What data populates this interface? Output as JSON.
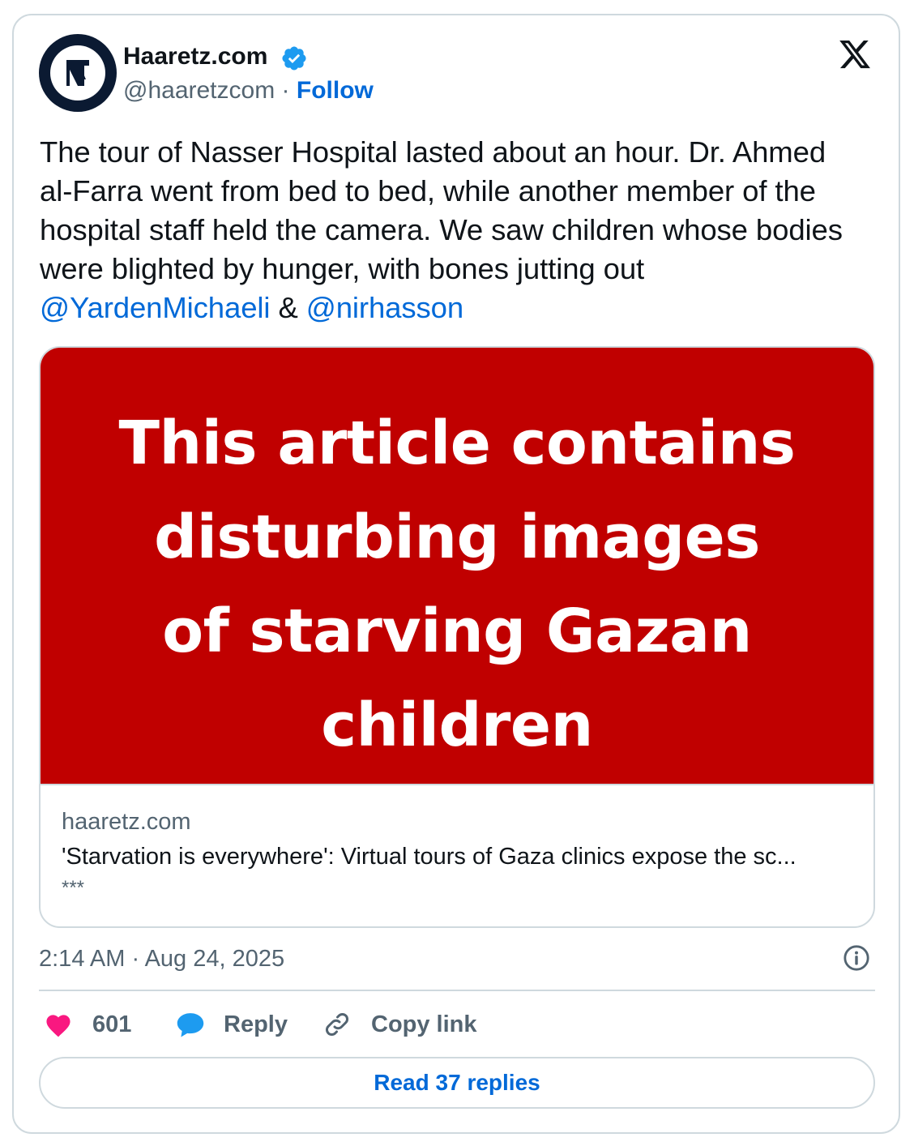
{
  "author": {
    "name": "Haaretz.com",
    "handle": "@haaretzcom",
    "separator": "·",
    "follow_label": "Follow"
  },
  "tweet": {
    "text_intro": "The tour of Nasser Hospital lasted about an hour. Dr. Ahmed al-Farra went from bed to bed, while another member of the hospital staff held the camera. We saw children whose bodies were blighted by hunger, with bones jutting out ",
    "mention_1": "@YardenMichaeli",
    "joiner": " & ",
    "mention_2": "@nirhasson"
  },
  "media": {
    "line1": "This article contains",
    "line2": "disturbing images",
    "line3": "of starving Gazan",
    "line4": "children",
    "background_color": "#c00000"
  },
  "link_card": {
    "domain": "haaretz.com",
    "title": "'Starvation is everywhere': Virtual tours of Gaza clinics expose the sc...",
    "subtitle": "***"
  },
  "timestamp": "2:14 AM · Aug 24, 2025",
  "actions": {
    "like_count": "601",
    "reply_label": "Reply",
    "copy_link_label": "Copy link"
  },
  "read_replies_label": "Read 37 replies",
  "colors": {
    "link_blue": "#0069d8",
    "heart_pink": "#f91880",
    "reply_blue": "#1d9bf0"
  }
}
